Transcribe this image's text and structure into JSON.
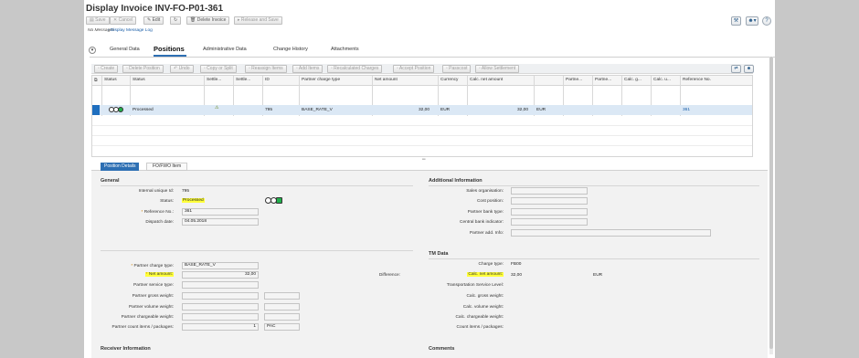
{
  "title": "Display Invoice INV-FO-P01-361",
  "toolbar": {
    "save": "Save",
    "cancel": "Cancel",
    "edit": "Edit",
    "delete_invoice": "Delete Invoice",
    "release_and_save": "Release and Save"
  },
  "messages": {
    "no_messages": "No Messages",
    "display_log": "Display Message Log"
  },
  "tabs": [
    "General Data",
    "Positions",
    "Administrative Data",
    "Change History",
    "Attachments"
  ],
  "positions_toolbar": [
    "Create",
    "Delete Position",
    "Undo",
    "Copy or Split",
    "Reassign Items",
    "Add Items",
    "Recalculated Charges",
    "Accept Position",
    "Passcost",
    "Allow Settlement"
  ],
  "table": {
    "headers": [
      "Status",
      "Status",
      "Settle...",
      "Settle...",
      "ID",
      "Partner charge type",
      "Net amount",
      "Currency",
      "Calc. net amount",
      "",
      "Partne...",
      "Partne...",
      "Calc. g...",
      "Calc. u...",
      "Reference No."
    ],
    "row": {
      "status": "Processed",
      "id": "795",
      "charge_type": "BASE_RATE_V",
      "net_amount": "32,00",
      "currency": "EUR",
      "calc_net_amount": "32,00",
      "calc_currency": "EUR",
      "reference": "361"
    }
  },
  "detail_tabs": [
    "Position Details",
    "FO/FWO Item"
  ],
  "general": {
    "title": "General",
    "internal_id_label": "Internal unique Id:",
    "internal_id": "795",
    "status_label": "Status:",
    "status": "Processed",
    "ref_label": "Reference No.:",
    "ref": "361",
    "dispatch_label": "Dispatch date:",
    "dispatch": "04.05.2018"
  },
  "additional": {
    "title": "Additional Information",
    "labels": [
      "Sales organisation:",
      "Cost position:",
      "Partner bank type:",
      "Central bank indicator:",
      "Partner add. Info:"
    ]
  },
  "charges": {
    "charge_type_label": "Partner charge type:",
    "charge_type": "BASE_RATE_V",
    "net_amount_label": "Net amount:",
    "net_amount": "32,00",
    "difference_label": "Difference:",
    "service_label": "Partner service type:",
    "gross_label": "Partner gross weight:",
    "volume_label": "Partner volume weight:",
    "chargeable_label": "Partner chargeable weight:",
    "count_label": "Partner count items / packages:",
    "count": "1",
    "count_unit": "PAC"
  },
  "tm": {
    "title": "TM Data",
    "charge_type_label": "Charge type:",
    "charge_type": "FB00",
    "calc_net_label": "Calc. net amount:",
    "calc_net": "32,00",
    "calc_currency": "EUR",
    "service_level_label": "Transportation Service Level:",
    "gross_label": "Calc. gross weight:",
    "volume_label": "Calc. volume weight:",
    "chargeable_label": "Calc. chargeable weight:",
    "count_label": "Count items / packages:"
  },
  "receiver": {
    "title": "Receiver Information"
  },
  "comments": {
    "title": "Comments"
  }
}
